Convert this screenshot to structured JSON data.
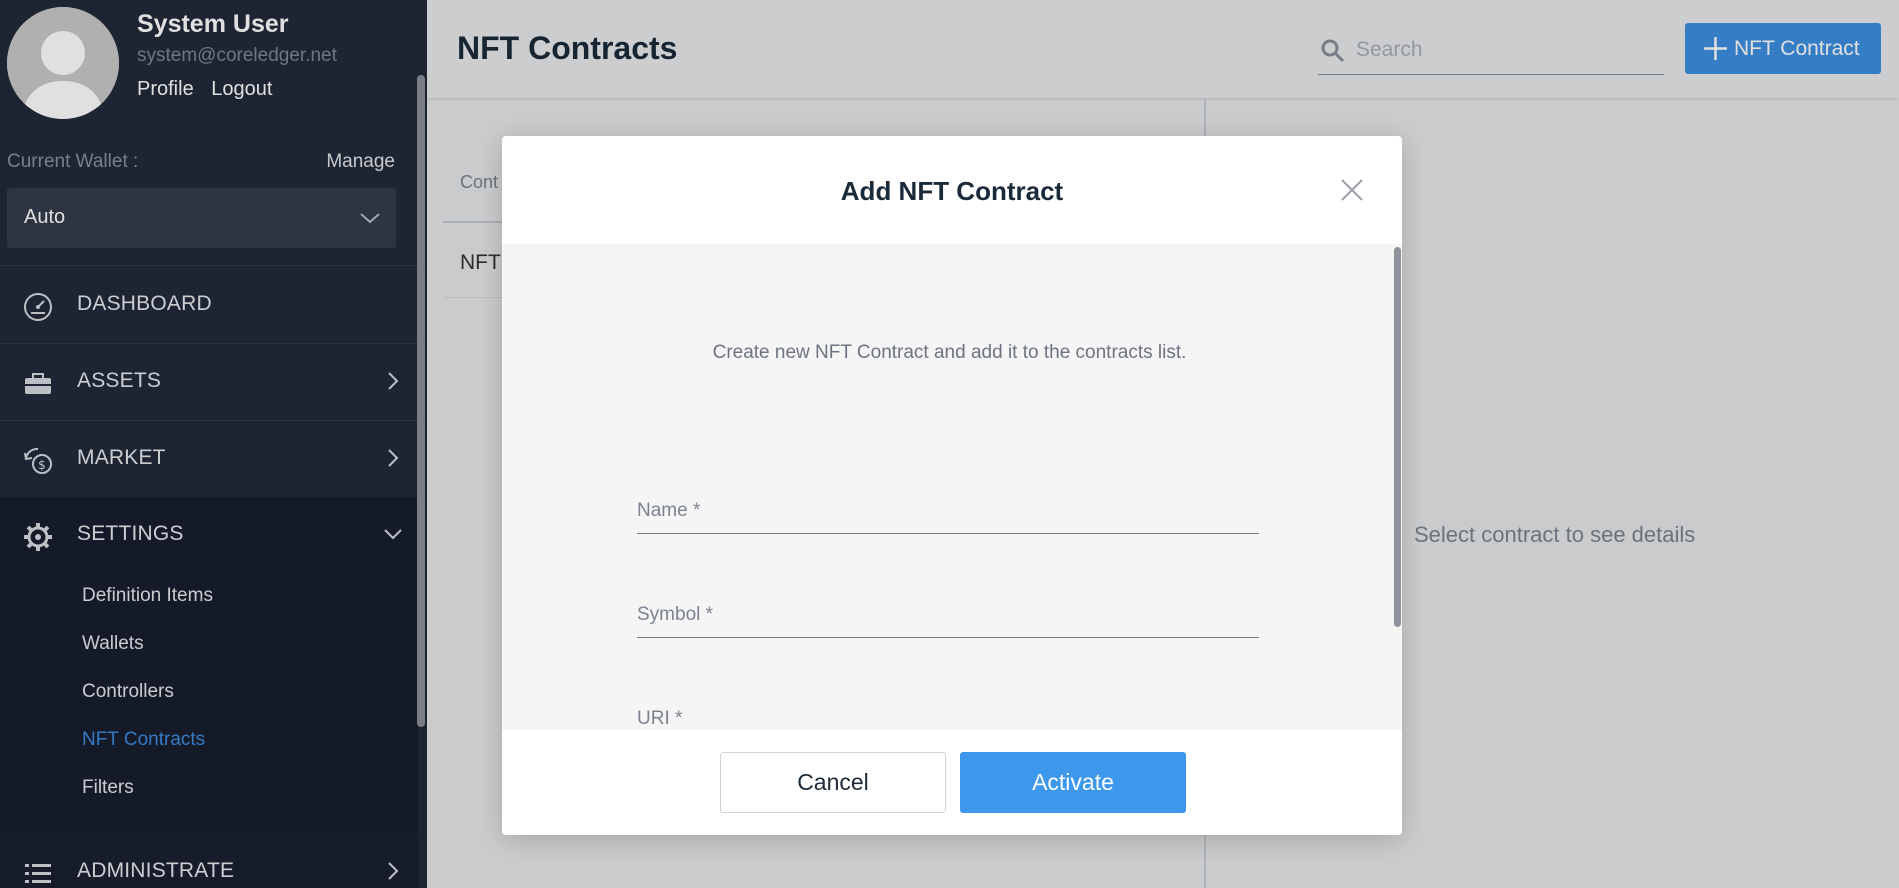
{
  "user": {
    "name": "System User",
    "email": "system@coreledger.net",
    "links": [
      "Profile",
      "Logout"
    ]
  },
  "wallet": {
    "label": "Current Wallet :",
    "manage": "Manage",
    "selected": "Auto"
  },
  "nav": {
    "dashboard": "DASHBOARD",
    "assets": "ASSETS",
    "market": "MARKET",
    "settings": "SETTINGS",
    "administrate": "ADMINISTRATE"
  },
  "settings_sub": [
    "Definition Items",
    "Wallets",
    "Controllers",
    "NFT Contracts",
    "Filters"
  ],
  "active_sub": "NFT Contracts",
  "header": {
    "title": "NFT Contracts",
    "search_placeholder": "Search",
    "add_button": "NFT Contract"
  },
  "list": {
    "column_header_partial": "Cont",
    "row_partial": "NFT"
  },
  "details": {
    "empty": "Select contract to see details"
  },
  "modal": {
    "title": "Add NFT Contract",
    "description": "Create new NFT Contract and add it to the contracts list.",
    "fields": {
      "name": "Name *",
      "symbol": "Symbol *",
      "uri": "URI *"
    },
    "cancel": "Cancel",
    "activate": "Activate"
  },
  "colors": {
    "sidebar": "#22293a",
    "accent": "#3d8fe0",
    "active_link": "#3c8ce0"
  }
}
